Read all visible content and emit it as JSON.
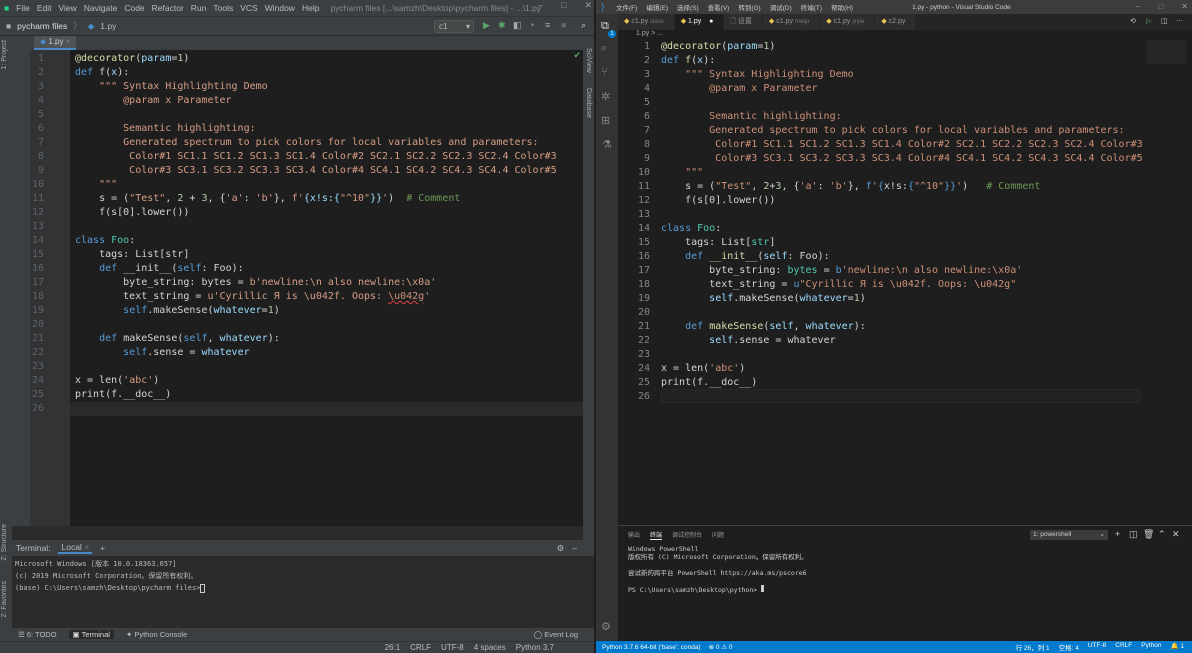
{
  "pycharm": {
    "menu": [
      "File",
      "Edit",
      "View",
      "Navigate",
      "Code",
      "Refactor",
      "Run",
      "Tools",
      "VCS",
      "Window",
      "Help"
    ],
    "window_title": "pycharm files [...\\samzh\\Desktop\\pycharm files] - ...\\1.py",
    "breadcrumb": {
      "project": "pycharm files",
      "file": "1.py"
    },
    "run_config": "c1",
    "tab": "1.py",
    "left_strip": [
      "1: Project",
      "Z: Structure",
      "2: Favorites"
    ],
    "right_strip": [
      "SciView",
      "Database"
    ],
    "terminal": {
      "label": "Terminal:",
      "tab": "Local",
      "lines": [
        "Microsoft Windows [版本 10.0.18363.657]",
        "(c) 2019 Microsoft Corporation。保留所有权利。",
        "",
        "(base) C:\\Users\\samzh\\Desktop\\pycharm files>"
      ]
    },
    "tool_tabs": [
      "6: TODO",
      "Terminal",
      "Python Console"
    ],
    "event_log": "Event Log",
    "status": [
      "26:1",
      "CRLF",
      "UTF-8",
      "4 spaces",
      "Python 3.7"
    ],
    "code": [
      [
        [
          "d",
          "@decorator"
        ],
        [
          "x",
          "("
        ],
        [
          "p",
          "param"
        ],
        [
          "x",
          "="
        ],
        [
          "n",
          "1"
        ],
        [
          "x",
          ")"
        ]
      ],
      [
        [
          "k",
          "def "
        ],
        [
          "f",
          "f"
        ],
        [
          "x",
          "("
        ],
        [
          "p",
          "x"
        ],
        [
          "x",
          "):"
        ]
      ],
      [
        [
          "s",
          "    \"\"\" Syntax Highlighting Demo"
        ]
      ],
      [
        [
          "s",
          "        @param x Parameter"
        ]
      ],
      [],
      [
        [
          "s",
          "        Semantic highlighting:"
        ]
      ],
      [
        [
          "s",
          "        Generated spectrum to pick colors for local variables and parameters:"
        ]
      ],
      [
        [
          "s",
          "         Color#1 SC1.1 SC1.2 SC1.3 SC1.4 Color#2 SC2.1 SC2.2 SC2.3 SC2.4 Color#3"
        ]
      ],
      [
        [
          "s",
          "         Color#3 SC3.1 SC3.2 SC3.3 SC3.4 Color#4 SC4.1 SC4.2 SC4.3 SC4.4 Color#5"
        ]
      ],
      [
        [
          "s",
          "    \"\"\""
        ]
      ],
      [
        [
          "x",
          "    s = ("
        ],
        [
          "s",
          "\"Test\""
        ],
        [
          "x",
          ", "
        ],
        [
          "n",
          "2"
        ],
        [
          "x",
          " + "
        ],
        [
          "n",
          "3"
        ],
        [
          "x",
          ", {"
        ],
        [
          "s",
          "'a'"
        ],
        [
          "x",
          ": "
        ],
        [
          "s",
          "'b'"
        ],
        [
          "x",
          "}, "
        ],
        [
          "s",
          "f'"
        ],
        [
          "p",
          "{x!s:{"
        ],
        [
          "s",
          "\"^10\""
        ],
        [
          "p",
          "}}"
        ],
        [
          "s",
          "'"
        ],
        [
          "x",
          ")  "
        ],
        [
          "c",
          "# Comment"
        ]
      ],
      [
        [
          "x",
          "    f(s[0].lower())"
        ]
      ],
      [],
      [
        [
          "k",
          "class "
        ],
        [
          "t",
          "Foo"
        ],
        [
          "x",
          ":"
        ]
      ],
      [
        [
          "x",
          "    tags: List[str]"
        ]
      ],
      [
        [
          "x",
          "    "
        ],
        [
          "k",
          "def "
        ],
        [
          "f",
          "__init__"
        ],
        [
          "x",
          "("
        ],
        [
          "k",
          "self"
        ],
        [
          "x",
          ": Foo):"
        ]
      ],
      [
        [
          "x",
          "        byte_string: "
        ],
        [
          "x",
          "bytes"
        ],
        [
          "x",
          " = "
        ],
        [
          "s",
          "b'newline:\\n also newline:\\x0a'"
        ]
      ],
      [
        [
          "x",
          "        text_string = "
        ],
        [
          "s",
          "u'Cyrillic Я is \\u042f. Oops: "
        ],
        [
          "e",
          "\\u042g"
        ],
        [
          "s",
          "'"
        ]
      ],
      [
        [
          "x",
          "        "
        ],
        [
          "k",
          "self"
        ],
        [
          "x",
          ".makeSense("
        ],
        [
          "p",
          "whatever"
        ],
        [
          "x",
          "="
        ],
        [
          "n",
          "1"
        ],
        [
          "x",
          ")"
        ]
      ],
      [],
      [
        [
          "x",
          "    "
        ],
        [
          "k",
          "def "
        ],
        [
          "f",
          "makeSense"
        ],
        [
          "x",
          "("
        ],
        [
          "k",
          "self"
        ],
        [
          "x",
          ", "
        ],
        [
          "p",
          "whatever"
        ],
        [
          "x",
          "):"
        ]
      ],
      [
        [
          "x",
          "        "
        ],
        [
          "k",
          "self"
        ],
        [
          "x",
          ".sense = "
        ],
        [
          "p",
          "whatever"
        ]
      ],
      [],
      [
        [
          "x",
          "x = len("
        ],
        [
          "s",
          "'abc'"
        ],
        [
          "x",
          ")"
        ]
      ],
      [
        [
          "x",
          "print(f.__doc__)"
        ]
      ],
      []
    ]
  },
  "vscode": {
    "menu": [
      "文件(F)",
      "编辑(E)",
      "选择(S)",
      "查看(V)",
      "转到(G)",
      "调试(D)",
      "终端(T)",
      "帮助(H)"
    ],
    "window_title": "1.py - python - Visual Studio Code",
    "activity_badge": "1",
    "tabs": [
      {
        "label": "c1.py",
        "sub": "class"
      },
      {
        "label": "1.py",
        "sub": "●"
      },
      {
        "label": "设置",
        "sub": ""
      },
      {
        "label": "c1.py",
        "sub": "meiju"
      },
      {
        "label": "c1.py",
        "sub": "jinjie"
      },
      {
        "label": "c2.py",
        "sub": ""
      }
    ],
    "breadcrumb": "1.py > ...",
    "panel_tabs": [
      "输出",
      "终端",
      "调试控制台",
      "问题"
    ],
    "terminal_select": "1: powershell",
    "terminal_lines": [
      "Windows PowerShell",
      "版权所有 (C) Microsoft Corporation。保留所有权利。",
      "",
      "尝试新的跨平台 PowerShell https://aka.ms/pscore6",
      "",
      "PS C:\\Users\\samzh\\Desktop\\python> "
    ],
    "status_left": [
      "Python 3.7.6 64-bit ('base': conda)",
      "⊗ 0 ⚠ 0"
    ],
    "status_right": [
      "行 26，列 1",
      "空格: 4",
      "UTF-8",
      "CRLF",
      "Python",
      "🔔 1"
    ],
    "code": [
      [
        [
          "d",
          "@decorator"
        ],
        [
          "x",
          "("
        ],
        [
          "p",
          "param"
        ],
        [
          "x",
          "="
        ],
        [
          "n",
          "1"
        ],
        [
          "x",
          ")"
        ]
      ],
      [
        [
          "k",
          "def "
        ],
        [
          "f",
          "f"
        ],
        [
          "x",
          "("
        ],
        [
          "p",
          "x"
        ],
        [
          "x",
          "):"
        ]
      ],
      [
        [
          "s",
          "    \"\"\" Syntax Highlighting Demo"
        ]
      ],
      [
        [
          "s",
          "        @param x Parameter"
        ]
      ],
      [],
      [
        [
          "s",
          "        Semantic highlighting:"
        ]
      ],
      [
        [
          "s",
          "        Generated spectrum to pick colors for local variables and parameters:"
        ]
      ],
      [
        [
          "s",
          "         Color#1 SC1.1 SC1.2 SC1.3 SC1.4 Color#2 SC2.1 SC2.2 SC2.3 SC2.4 Color#3"
        ]
      ],
      [
        [
          "s",
          "         Color#3 SC3.1 SC3.2 SC3.3 SC3.4 Color#4 SC4.1 SC4.2 SC4.3 SC4.4 Color#5"
        ]
      ],
      [
        [
          "s",
          "    \"\"\""
        ]
      ],
      [
        [
          "x",
          "    s = ("
        ],
        [
          "s",
          "\"Test\""
        ],
        [
          "x",
          ", "
        ],
        [
          "n",
          "2"
        ],
        [
          "x",
          "+"
        ],
        [
          "n",
          "3"
        ],
        [
          "x",
          ", {"
        ],
        [
          "s",
          "'a'"
        ],
        [
          "x",
          ": "
        ],
        [
          "s",
          "'b'"
        ],
        [
          "x",
          "}, "
        ],
        [
          "k",
          "f"
        ],
        [
          "s",
          "'"
        ],
        [
          "k",
          "{"
        ],
        [
          "x",
          "x!s:"
        ],
        [
          "k",
          "{"
        ],
        [
          "s",
          "\"^10\""
        ],
        [
          "k",
          "}}"
        ],
        [
          "s",
          "'"
        ],
        [
          "x",
          ")   "
        ],
        [
          "c",
          "# Comment"
        ]
      ],
      [
        [
          "x",
          "    f(s[0].lower())"
        ]
      ],
      [],
      [
        [
          "k",
          "class "
        ],
        [
          "t",
          "Foo"
        ],
        [
          "x",
          ":"
        ]
      ],
      [
        [
          "x",
          "    tags: List["
        ],
        [
          "t",
          "str"
        ],
        [
          "x",
          "]"
        ]
      ],
      [
        [
          "x",
          "    "
        ],
        [
          "k",
          "def "
        ],
        [
          "f",
          "__init__"
        ],
        [
          "x",
          "("
        ],
        [
          "p",
          "self"
        ],
        [
          "x",
          ": Foo):"
        ]
      ],
      [
        [
          "x",
          "        byte_string: "
        ],
        [
          "t",
          "bytes"
        ],
        [
          "x",
          " = "
        ],
        [
          "k",
          "b"
        ],
        [
          "s",
          "'newline:\\n also newline:\\x0a'"
        ]
      ],
      [
        [
          "x",
          "        text_string = "
        ],
        [
          "k",
          "u"
        ],
        [
          "s",
          "\"Cyrillic Я is \\u042f. Oops: \\u042g\""
        ]
      ],
      [
        [
          "x",
          "        "
        ],
        [
          "p",
          "self"
        ],
        [
          "x",
          ".makeSense("
        ],
        [
          "p",
          "whatever"
        ],
        [
          "x",
          "="
        ],
        [
          "n",
          "1"
        ],
        [
          "x",
          ")"
        ]
      ],
      [],
      [
        [
          "x",
          "    "
        ],
        [
          "k",
          "def "
        ],
        [
          "f",
          "makeSense"
        ],
        [
          "x",
          "("
        ],
        [
          "p",
          "self"
        ],
        [
          "x",
          ", "
        ],
        [
          "p",
          "whatever"
        ],
        [
          "x",
          "):"
        ]
      ],
      [
        [
          "x",
          "        "
        ],
        [
          "p",
          "self"
        ],
        [
          "x",
          ".sense = whatever"
        ]
      ],
      [],
      [
        [
          "x",
          "x = len("
        ],
        [
          "s",
          "'abc'"
        ],
        [
          "x",
          ")"
        ]
      ],
      [
        [
          "x",
          "print(f.__doc__)"
        ]
      ],
      []
    ]
  },
  "colors": {
    "vscode_status": "#007acc",
    "pycharm_bg": "#2b2b2b"
  }
}
